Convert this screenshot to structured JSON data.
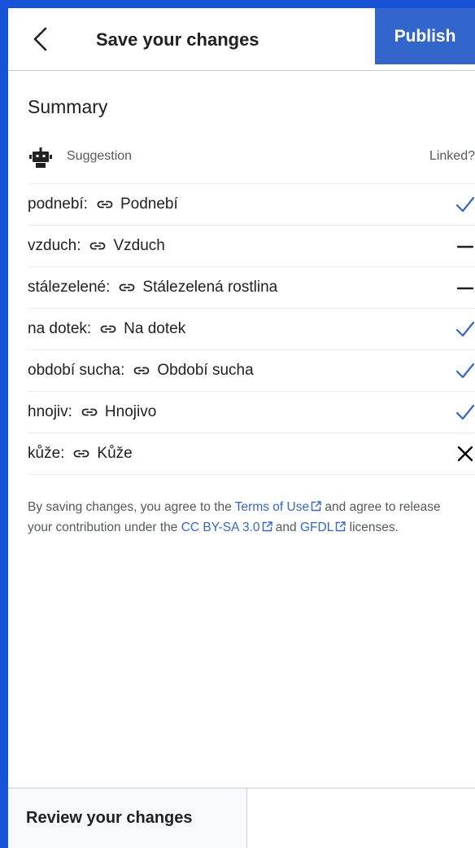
{
  "header": {
    "title": "Save your changes",
    "back_icon": "chevron-left-icon",
    "publish_label": "Publish"
  },
  "summary": {
    "title": "Summary",
    "suggestion_header": "Suggestion",
    "linked_header": "Linked?",
    "rows": [
      {
        "word": "podnebí:",
        "target": "Podnebí",
        "status": "check"
      },
      {
        "word": "vzduch:",
        "target": "Vzduch",
        "status": "dash"
      },
      {
        "word": "stálezelené:",
        "target": "Stálezelená rostlina",
        "status": "dash"
      },
      {
        "word": "na dotek:",
        "target": "Na dotek",
        "status": "check"
      },
      {
        "word": "období sucha:",
        "target": "Období sucha",
        "status": "check"
      },
      {
        "word": "hnojiv:",
        "target": "Hnojivo",
        "status": "check"
      },
      {
        "word": "kůže:",
        "target": "Kůže",
        "status": "cross"
      }
    ]
  },
  "legal": {
    "part1": "By saving changes, you agree to the ",
    "terms_link": "Terms of Use",
    "part2": " and agree to release your contribution under the ",
    "cc_link": "CC BY-SA 3.0",
    "part3": " and ",
    "gfdl_link": "GFDL",
    "part4": " licenses."
  },
  "footer": {
    "review_label": "Review your changes"
  },
  "colors": {
    "accent": "#3366cc",
    "background_frame": "#1653d8",
    "text": "#202122",
    "muted": "#54595d"
  }
}
